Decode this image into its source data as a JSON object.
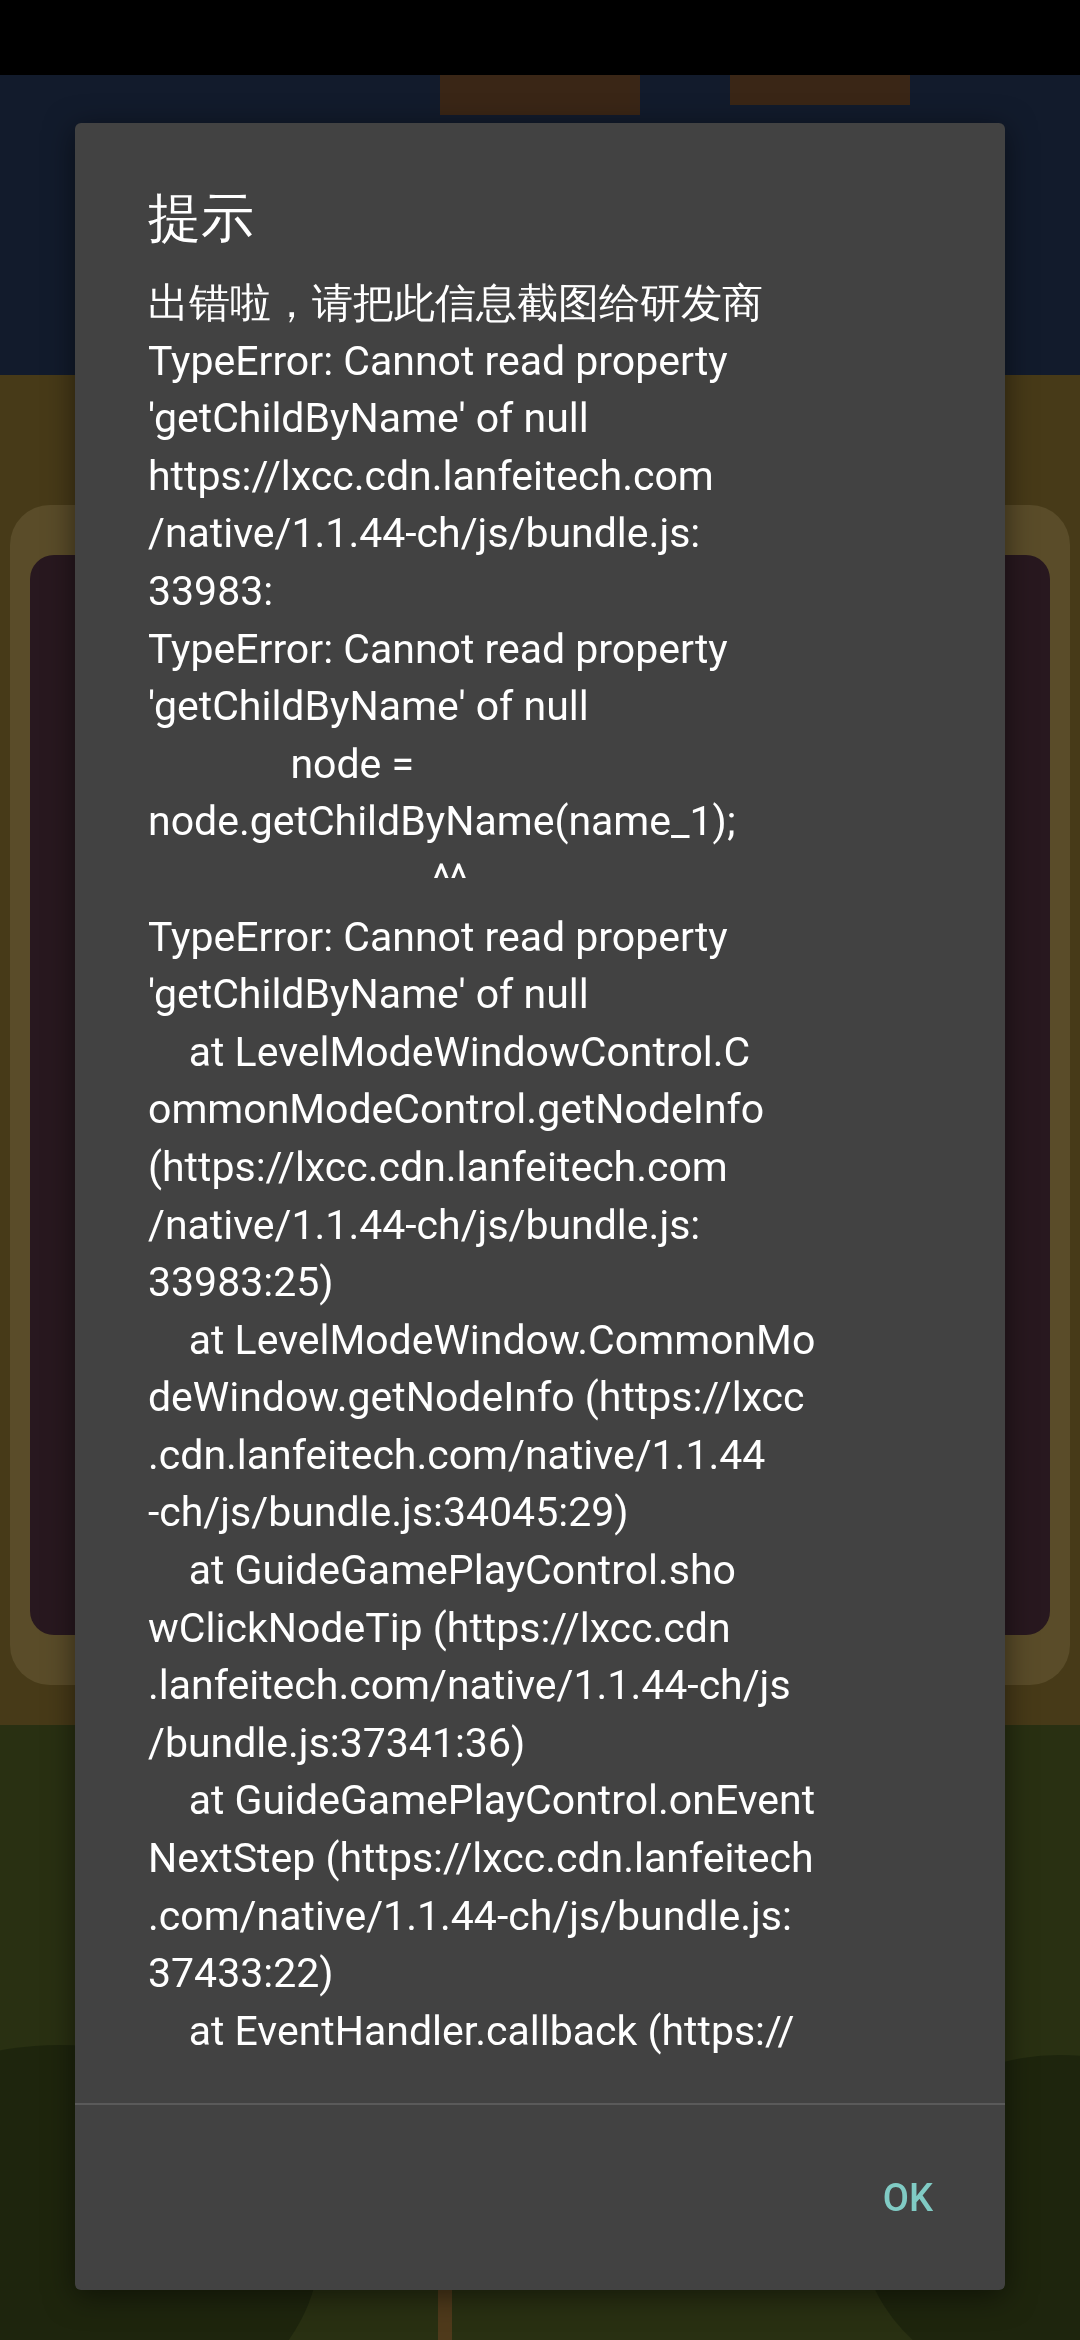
{
  "dialog": {
    "title": "提示",
    "message": "出错啦，请把此信息截图给研发商\nTypeError: Cannot read property\n'getChildByName' of null\nhttps://lxcc.cdn.lanfeitech.com\n/native/1.1.44-ch/js/bundle.js:\n33983:\nTypeError: Cannot read property\n'getChildByName' of null\n              node =\nnode.getChildByName(name_1);\n                            ^^\nTypeError: Cannot read property\n'getChildByName' of null\n    at LevelModeWindowControl.C\nommonModeControl.getNodeInfo\n(https://lxcc.cdn.lanfeitech.com\n/native/1.1.44-ch/js/bundle.js:\n33983:25)\n    at LevelModeWindow.CommonMo\ndeWindow.getNodeInfo (https://lxcc\n.cdn.lanfeitech.com/native/1.1.44\n-ch/js/bundle.js:34045:29)\n    at GuideGamePlayControl.sho\nwClickNodeTip (https://lxcc.cdn\n.lanfeitech.com/native/1.1.44-ch/js\n/bundle.js:37341:36)\n    at GuideGamePlayControl.onEvent\nNextStep (https://lxcc.cdn.lanfeitech\n.com/native/1.1.44-ch/js/bundle.js:\n37433:22)\n    at EventHandler.callback (https://",
    "buttons": [
      "OK"
    ]
  }
}
